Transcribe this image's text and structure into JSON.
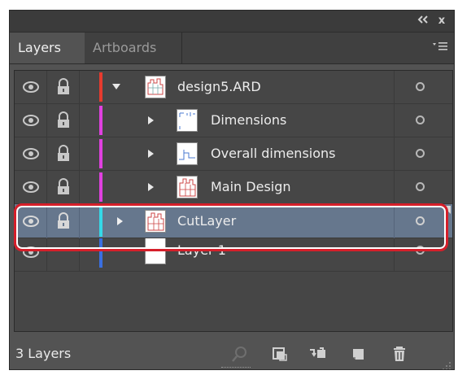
{
  "panel": {
    "titlebar": {
      "collapse_icon": "double-left-arrow-icon",
      "close_label": "x"
    },
    "tabs": [
      {
        "label": "Layers",
        "active": true
      },
      {
        "label": "Artboards",
        "active": false
      }
    ],
    "menu_icon": "panel-menu-icon"
  },
  "layers": {
    "rows": [
      {
        "name": "design5.ARD",
        "level": 0,
        "expanded": true,
        "visible": true,
        "locked": true,
        "color": "#e63b2e",
        "selected": false
      },
      {
        "name": "Dimensions",
        "level": 1,
        "expanded": false,
        "visible": true,
        "locked": true,
        "color": "#e040e0",
        "selected": false
      },
      {
        "name": "Overall dimensions",
        "level": 1,
        "expanded": false,
        "visible": true,
        "locked": true,
        "color": "#e040e0",
        "selected": false
      },
      {
        "name": "Main Design",
        "level": 1,
        "expanded": false,
        "visible": true,
        "locked": true,
        "color": "#e040e0",
        "selected": false
      },
      {
        "name": "CutLayer",
        "level": 0,
        "expanded": false,
        "visible": true,
        "locked": true,
        "color": "#35d9e8",
        "selected": true
      },
      {
        "name": "Layer 1",
        "level": 0,
        "expanded": null,
        "visible": true,
        "locked": false,
        "color": "#3a6fe0",
        "selected": false
      }
    ]
  },
  "footer": {
    "count_label": "3 Layers",
    "icons": [
      "locate-object-icon",
      "make-clipping-mask-icon",
      "create-sublayer-icon",
      "create-new-layer-icon",
      "delete-layer-icon"
    ]
  },
  "colors": {
    "panel_bg": "#535353",
    "selection_bg": "#66778d",
    "highlight_outline": "#d51f2a"
  }
}
